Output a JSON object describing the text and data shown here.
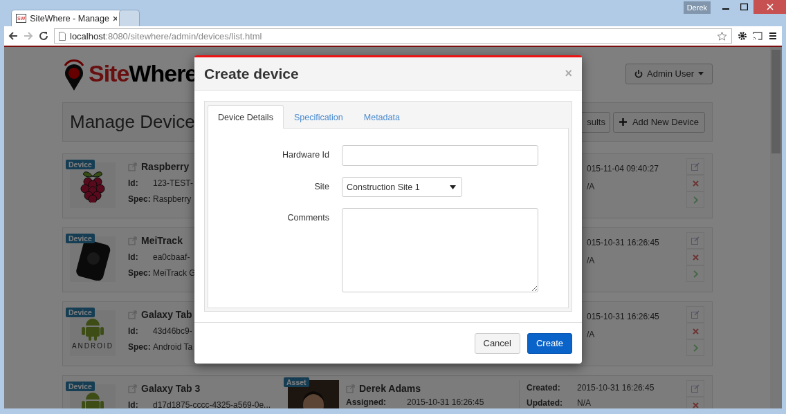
{
  "browser": {
    "tabs": [
      {
        "icon_text": "SW",
        "title": "SiteWhere - Manage",
        "selected": true
      },
      {
        "selected": false
      }
    ],
    "profile": "Derek",
    "url_host": "localhost",
    "url_path": ":8080/sitewhere/admin/devices/list.html"
  },
  "page": {
    "logo": {
      "site": "Site",
      "where": "Where"
    },
    "user_button": "Admin User",
    "title": "Manage Device",
    "toolbar_buttons": [
      {
        "kind": "plain",
        "label": "sults"
      },
      {
        "kind": "add",
        "label": "Add New Device"
      }
    ],
    "devices": [
      {
        "badge": "Device",
        "title": "Raspberry",
        "id_label": "Id:",
        "id": "123-TEST-",
        "spec_label": "Spec:",
        "spec": "Raspberry",
        "created": "015-11-04 09:40:27",
        "updated": "/A"
      },
      {
        "badge": "Device",
        "title": "MeiTrack",
        "id_label": "Id:",
        "id": "ea0cbaaf-",
        "spec_label": "Spec:",
        "spec": "MeiTrack G",
        "created": "015-10-31 16:26:45",
        "updated": "/A"
      },
      {
        "badge": "Device",
        "image_caption": "ANDROID",
        "title": "Galaxy Tab",
        "id_label": "Id:",
        "id": "43d46bc9-",
        "spec_label": "Spec:",
        "spec": "Android Ta",
        "created": "015-10-31 16:26:45",
        "updated": "/A"
      },
      {
        "badge": "Device",
        "title": "Galaxy Tab 3",
        "id_label": "Id:",
        "id": "d17d1875-cccc-4325-a569-0e...",
        "asset": {
          "badge": "Asset",
          "name": "Derek Adams",
          "assigned_label": "Assigned:",
          "assigned": "2015-10-31 16:26:45"
        },
        "created_label": "Created:",
        "created": "2015-10-31 16:26:45",
        "updated_label": "Updated:",
        "updated": "N/A"
      }
    ]
  },
  "modal": {
    "title": "Create device",
    "close": "×",
    "tabs": [
      {
        "label": "Device Details",
        "selected": true
      },
      {
        "label": "Specification",
        "selected": false
      },
      {
        "label": "Metadata",
        "selected": false
      }
    ],
    "fields": [
      {
        "kind": "input",
        "label": "Hardware Id"
      },
      {
        "kind": "select",
        "label": "Site",
        "value": "Construction Site 1"
      },
      {
        "kind": "textarea",
        "label": "Comments"
      }
    ],
    "buttons": [
      {
        "kind": "default",
        "label": "Cancel"
      },
      {
        "kind": "primary",
        "label": "Create"
      }
    ]
  }
}
